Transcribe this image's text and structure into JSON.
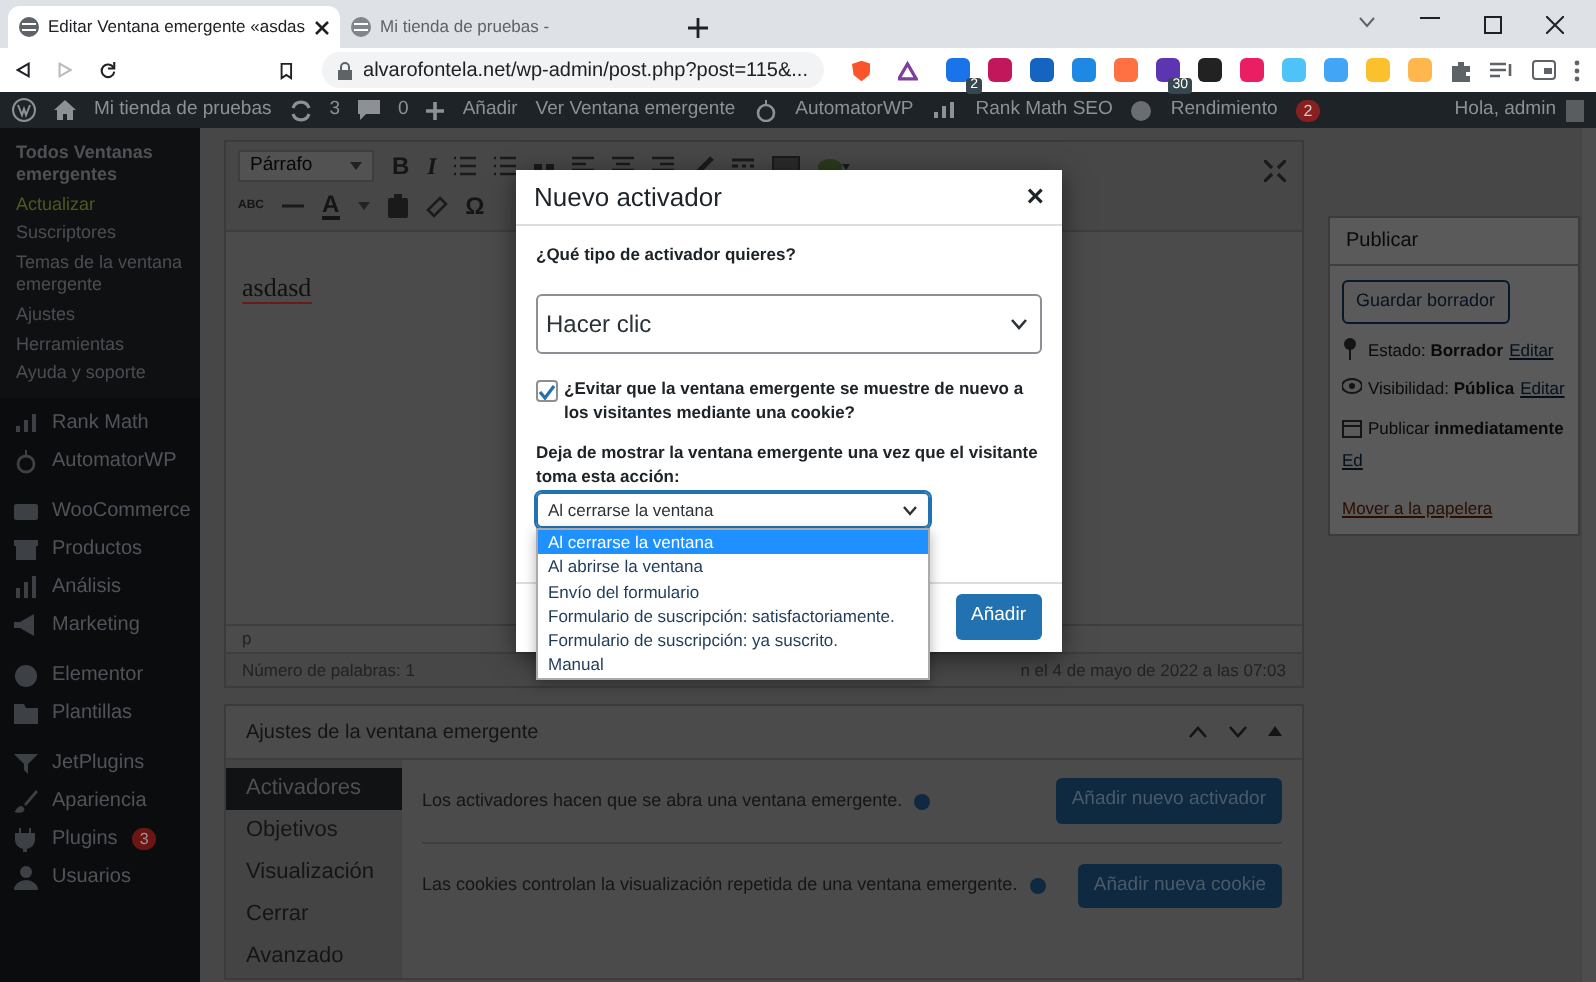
{
  "browser": {
    "tabs": [
      {
        "title": "Editar Ventana emergente «asdas",
        "selected": true
      },
      {
        "title": "Mi tienda de pruebas -",
        "selected": false
      }
    ],
    "address": "alvarofontela.net/wp-admin/post.php?post=115&...",
    "extensions": [
      {
        "color": "#1a73e8",
        "badge": "2"
      },
      {
        "color": "#c2185b"
      },
      {
        "color": "#1565c0"
      },
      {
        "color": "#1e88e5"
      },
      {
        "color": "#ff7043"
      },
      {
        "color": "#5e35b1",
        "badge": "30"
      },
      {
        "color": "#222222"
      },
      {
        "color": "#e91e63"
      },
      {
        "color": "#4fc3f7"
      },
      {
        "color": "#42a5f5"
      },
      {
        "color": "#fbc02d"
      },
      {
        "color": "#ffb74d"
      }
    ]
  },
  "admin_bar": {
    "site": "Mi tienda de pruebas",
    "updates": "3",
    "comments": "0",
    "new": "Añadir",
    "view": "Ver Ventana emergente",
    "automator": "AutomatorWP",
    "rank_math": "Rank Math SEO",
    "performance": "Rendimiento",
    "performance_badge": "2",
    "greeting": "Hola, admin"
  },
  "sidebar": {
    "submenu": [
      {
        "label": "Todos Ventanas emergentes",
        "selected": true,
        "kind": "normal"
      },
      {
        "label": "Actualizar",
        "selected": false,
        "kind": "highlight"
      },
      {
        "label": "Suscriptores",
        "selected": false,
        "kind": "normal"
      },
      {
        "label": "Temas de la ventana emergente",
        "selected": false,
        "kind": "normal"
      },
      {
        "label": "Ajustes",
        "selected": false,
        "kind": "normal"
      },
      {
        "label": "Herramientas",
        "selected": false,
        "kind": "normal"
      },
      {
        "label": "Ayuda y soporte",
        "selected": false,
        "kind": "normal"
      }
    ],
    "groups": [
      [
        {
          "label": "Rank Math"
        },
        {
          "label": "AutomatorWP"
        }
      ],
      [
        {
          "label": "WooCommerce"
        },
        {
          "label": "Productos"
        },
        {
          "label": "Análisis"
        },
        {
          "label": "Marketing"
        }
      ],
      [
        {
          "label": "Elementor"
        },
        {
          "label": "Plantillas"
        }
      ],
      [
        {
          "label": "JetPlugins"
        },
        {
          "label": "Apariencia"
        },
        {
          "label": "Plugins",
          "badge": "3"
        },
        {
          "label": "Usuarios"
        }
      ]
    ]
  },
  "editor": {
    "format": "Párrafo",
    "toolbar_1": [
      "B",
      "I"
    ],
    "toolbar_2": [
      "ABC",
      "A",
      "Ω"
    ],
    "content": "asdasd",
    "path": "p",
    "word_count": "Número de palabras: 1",
    "last_edit": "n el 4 de mayo de 2022 a las 07:03"
  },
  "publish": {
    "title": "Publicar",
    "save": "Guardar borrador",
    "rows": [
      {
        "text": "Estado: **Borrador**",
        "link": "Editar"
      },
      {
        "text": "Visibilidad: **Pública**",
        "link": "Editar"
      },
      {
        "text": "Publicar **inmediatamente**",
        "link": "Ed"
      }
    ],
    "trash": "Mover a la papelera"
  },
  "metabox": {
    "title": "Ajustes de la ventana emergente",
    "tabs": [
      {
        "label": "Activadores",
        "selected": true
      },
      {
        "label": "Objetivos",
        "selected": false
      },
      {
        "label": "Visualización",
        "selected": false
      },
      {
        "label": "Cerrar",
        "selected": false
      },
      {
        "label": "Avanzado",
        "selected": false
      }
    ],
    "sections": [
      {
        "text": "Los activadores hacen que se abra una ventana emergente.",
        "button": "Añadir nuevo activador"
      },
      {
        "text": "Las cookies controlan la visualización repetida de una ventana emergente.",
        "button": "Añadir nueva cookie"
      }
    ]
  },
  "modal": {
    "title": "Nuevo activador",
    "close": "×",
    "type_label": "¿Qué tipo de activador quieres?",
    "type_value": "Hacer clic",
    "cookie": {
      "label": "¿Evitar que la ventana emergente se muestre de nuevo a los visitantes mediante una cookie?",
      "checked": true
    },
    "stop_label": "Deja de mostrar la ventana emergente una vez que el visitante toma esta acción:",
    "stop_value": "Al cerrarse la ventana",
    "expanded": true,
    "options": [
      {
        "label": "Al cerrarse la ventana",
        "selected": true
      },
      {
        "label": "Al abrirse la ventana",
        "selected": false
      },
      {
        "label": "Envío del formulario",
        "selected": false
      },
      {
        "label": "Formulario de suscripción: satisfactoriamente.",
        "selected": false
      },
      {
        "label": "Formulario de suscripción: ya suscrito.",
        "selected": false
      },
      {
        "label": "Manual",
        "selected": false
      }
    ],
    "submit": "Añadir"
  }
}
